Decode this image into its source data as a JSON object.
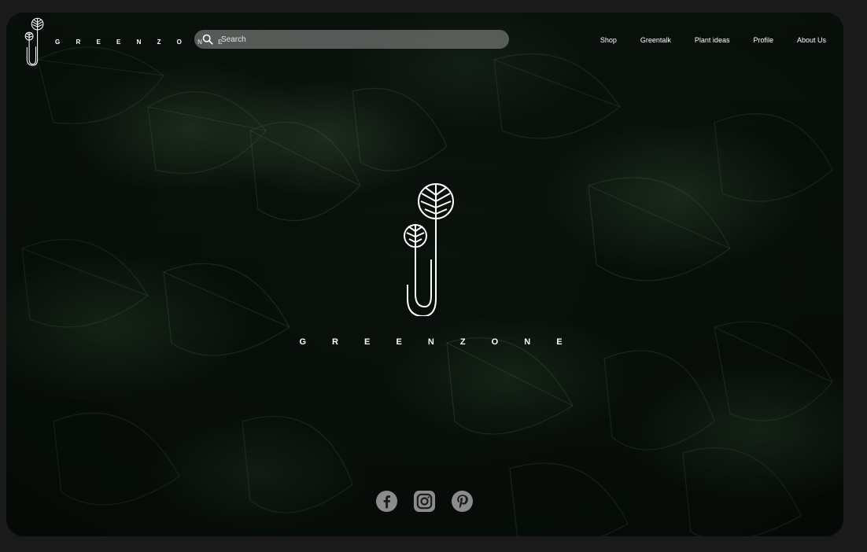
{
  "brand": {
    "name": "G R E E N Z O N E"
  },
  "search": {
    "placeholder": "Search"
  },
  "nav": {
    "items": [
      {
        "label": "Shop"
      },
      {
        "label": "Greentalk"
      },
      {
        "label": "Plant ideas"
      },
      {
        "label": "Profile"
      },
      {
        "label": "About Us"
      }
    ]
  },
  "hero": {
    "brand_name": "G R E E N Z O N E"
  },
  "social": {
    "icons": [
      "facebook-icon",
      "instagram-icon",
      "pinterest-icon"
    ]
  },
  "colors": {
    "accent": "#ffffff",
    "background": "#0b140d",
    "search_bg": "#969696",
    "social_icon": "#8c8c8c"
  }
}
